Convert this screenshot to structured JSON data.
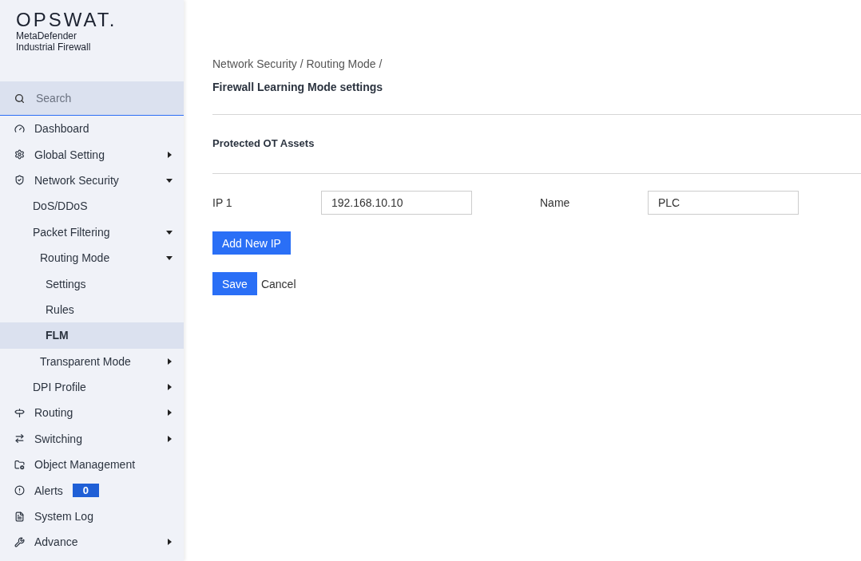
{
  "brand": {
    "logo": "OPSWAT.",
    "product_line_1": "MetaDefender",
    "product_line_2": "Industrial Firewall"
  },
  "search": {
    "placeholder": "Search"
  },
  "sidebar": {
    "items": [
      {
        "label": "Dashboard",
        "selected": false
      },
      {
        "label": "Global Setting",
        "selected": false,
        "expanded": false
      },
      {
        "label": "Network Security",
        "selected": false,
        "expanded": true,
        "children": [
          {
            "label": "DoS/DDoS",
            "selected": false
          },
          {
            "label": "Packet Filtering",
            "selected": false,
            "expanded": true,
            "children": [
              {
                "label": "Routing Mode",
                "selected": false,
                "expanded": true,
                "children": [
                  {
                    "label": "Settings",
                    "selected": false
                  },
                  {
                    "label": "Rules",
                    "selected": false
                  },
                  {
                    "label": "FLM",
                    "selected": true
                  }
                ]
              },
              {
                "label": "Transparent Mode",
                "selected": false,
                "expanded": false
              }
            ]
          },
          {
            "label": "DPI Profile",
            "selected": false,
            "expanded": false
          }
        ]
      },
      {
        "label": "Routing",
        "selected": false,
        "expanded": false
      },
      {
        "label": "Switching",
        "selected": false,
        "expanded": false
      },
      {
        "label": "Object Management",
        "selected": false
      },
      {
        "label": "Alerts",
        "selected": false,
        "badge": "0"
      },
      {
        "label": "System Log",
        "selected": false
      },
      {
        "label": "Advance",
        "selected": false,
        "expanded": false
      }
    ]
  },
  "breadcrumb": "Network Security / Routing Mode /",
  "page_title": "Firewall Learning Mode settings",
  "section_title": "Protected OT Assets",
  "assets": [
    {
      "ip_label": "IP 1",
      "ip_value": "192.168.10.10",
      "name_label": "Name",
      "name_value": "PLC"
    }
  ],
  "add_button": "Add New IP",
  "save_button": "Save",
  "cancel_button": "Cancel"
}
